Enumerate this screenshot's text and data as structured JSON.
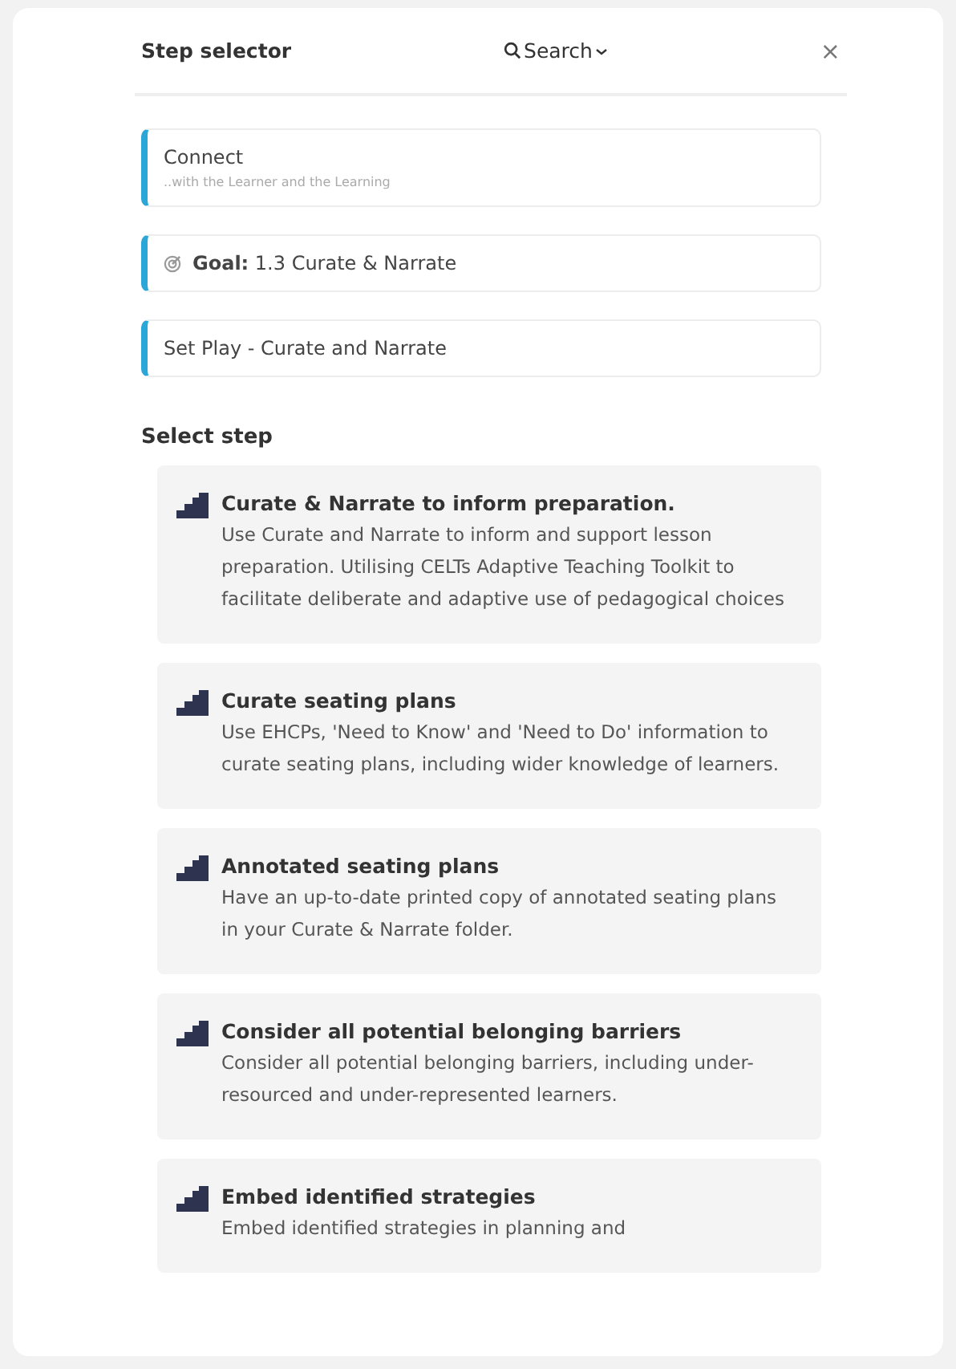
{
  "header": {
    "title": "Step selector",
    "search_label": "Search",
    "close": "×"
  },
  "context_cards": [
    {
      "kind": "connect",
      "title": "Connect",
      "subtitle": "..with the Learner and the Learning"
    },
    {
      "kind": "goal",
      "title": "**Goal:** 1.3 Curate & Narrate"
    },
    {
      "kind": "plain",
      "title": "Set Play - Curate and Narrate"
    }
  ],
  "section_title": "Select step",
  "steps": [
    {
      "title": "Curate & Narrate to inform preparation.",
      "description": "Use Curate and Narrate to inform and support lesson preparation. Utilising CELTs Adaptive Teaching Toolkit to facilitate deliberate and adaptive use of pedagogical choices"
    },
    {
      "title": "Curate seating plans",
      "description": "Use EHCPs, 'Need to Know' and 'Need to Do' information to curate seating plans, including wider knowledge of learners."
    },
    {
      "title": "Annotated seating plans",
      "description": "Have an up-to-date printed copy of annotated seating plans in your Curate & Narrate folder."
    },
    {
      "title": "Consider all potential belonging barriers",
      "description": "Consider all potential belonging barriers, including under-resourced and under-represented learners."
    },
    {
      "title": "Embed identified strategies",
      "description": "Embed identified strategies in planning and"
    }
  ]
}
